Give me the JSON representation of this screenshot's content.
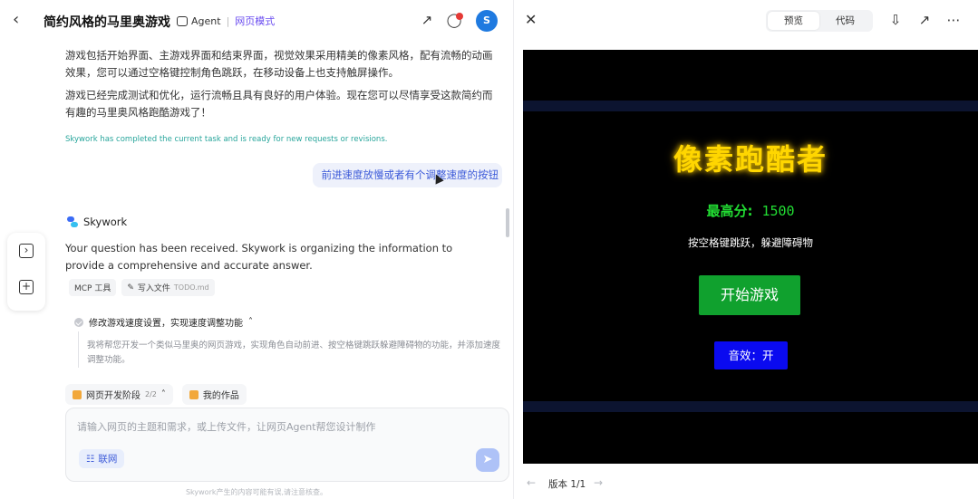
{
  "left": {
    "header": {
      "back_icon": "chevron-left-icon",
      "title": "简约风格的马里奥游戏",
      "agent_label": "Agent",
      "mode_label": "网页模式",
      "avatar_letter": "S",
      "notification_badge_color": "#e53935"
    },
    "messages": {
      "paragraph1": "游戏包括开始界面、主游戏界面和结束界面，视觉效果采用精美的像素风格，配有流畅的动画效果，您可以通过空格键控制角色跳跃，在移动设备上也支持触屏操作。",
      "paragraph2": "游戏已经完成测试和优化，运行流畅且具有良好的用户体验。现在您可以尽情享受这款简约而有趣的马里奥风格跑酷游戏了！",
      "complete_notice": "Skywork has completed the current task and is ready for new requests or revisions.",
      "user_message": "前进速度放慢或者有个调整速度的按钮"
    },
    "assistant": {
      "name": "Skywork",
      "reply": "Your question has been received. Skywork is organizing the information to provide a comprehensive and accurate answer.",
      "chips": [
        {
          "label": "MCP 工具"
        },
        {
          "label": "写入文件",
          "sub": "TODO.md"
        }
      ],
      "task_title": "修改游戏速度设置，实现速度调整功能",
      "task_desc": "我将帮您开发一个类似马里奥的网页游戏，实现角色自动前进、按空格键跳跃躲避障碍物的功能，并添加速度调整功能。"
    },
    "tags": [
      {
        "label": "网页开发阶段",
        "count": "2/2"
      },
      {
        "label": "我的作品"
      }
    ],
    "composer": {
      "placeholder": "请输入网页的主题和需求，或上传文件，让网页Agent帮您设计制作",
      "net_button": "联网"
    },
    "disclaimer": "Skywork产生的内容可能有误,请注意核查。"
  },
  "right": {
    "tabs": [
      "预览",
      "代码"
    ],
    "active_tab": 0,
    "game": {
      "title": "像素跑酷者",
      "high_score_label": "最高分:",
      "high_score_value": "1500",
      "hint": "按空格键跳跃，躲避障碍物",
      "start_button": "开始游戏",
      "sound_button": "音效：开",
      "colors": {
        "title": "#ffd600",
        "score": "#22dd33",
        "start_bg": "#10a12e",
        "sound_bg": "#0a0af0"
      }
    },
    "version_label": "版本 1/1"
  }
}
